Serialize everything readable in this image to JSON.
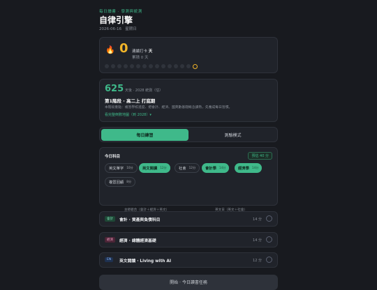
{
  "header": {
    "tagline": "每日讀書 · 學測與統測",
    "title": "自律引擎",
    "date": "2026-06-16",
    "weekday": "星期日"
  },
  "streak": {
    "count": "0",
    "line1_prefix": "連續打卡",
    "line1_unit": "天",
    "line2": "累積 0 天",
    "dot_count": 15,
    "colors": {
      "today_ring": "#f0b429",
      "accent": "#3fb98a"
    }
  },
  "exam": {
    "days": "625",
    "days_caption": "天後 · 2028 統測（估）",
    "phase": "第1階段 · 高二上 打底期",
    "phase_desc": "本階段重點：複習學校進度、把會計、經濟、國英數基礎概念讀熟，先養成每日習慣。",
    "map_link": "看完整倒數地圖（到 2028）▾"
  },
  "mode": {
    "tab_daily": "每日練習",
    "tab_exam": "測驗模式"
  },
  "today": {
    "title": "今日科目",
    "total": "預估 40 分",
    "subjects": [
      {
        "label": "英文單字",
        "minutes": "10分",
        "selected": false
      },
      {
        "label": "英文閱讀",
        "minutes": "12分",
        "selected": true
      },
      {
        "label": "社會",
        "minutes": "12分",
        "selected": false
      },
      {
        "label": "會計學",
        "minutes": "14分",
        "selected": true
      },
      {
        "label": "經濟學",
        "minutes": "14分",
        "selected": true
      },
      {
        "label": "複習回顧",
        "minutes": "8分",
        "selected": false
      }
    ],
    "combo_a": "主修組合（會計＋經濟＋英文）",
    "combo_b": "英文日（英文＋社會）"
  },
  "tasks": [
    {
      "tag": "會計",
      "title": "會計 · 資產與負債科目",
      "minutes": "14 分"
    },
    {
      "tag": "經濟",
      "title": "經濟 · 總體經濟基礎",
      "minutes": "14 分"
    },
    {
      "tag": "EN",
      "title": "英文閱讀 · Living with AI",
      "minutes": "12 分"
    }
  ],
  "cta": {
    "label": "開始 · 今日讀書任務"
  }
}
